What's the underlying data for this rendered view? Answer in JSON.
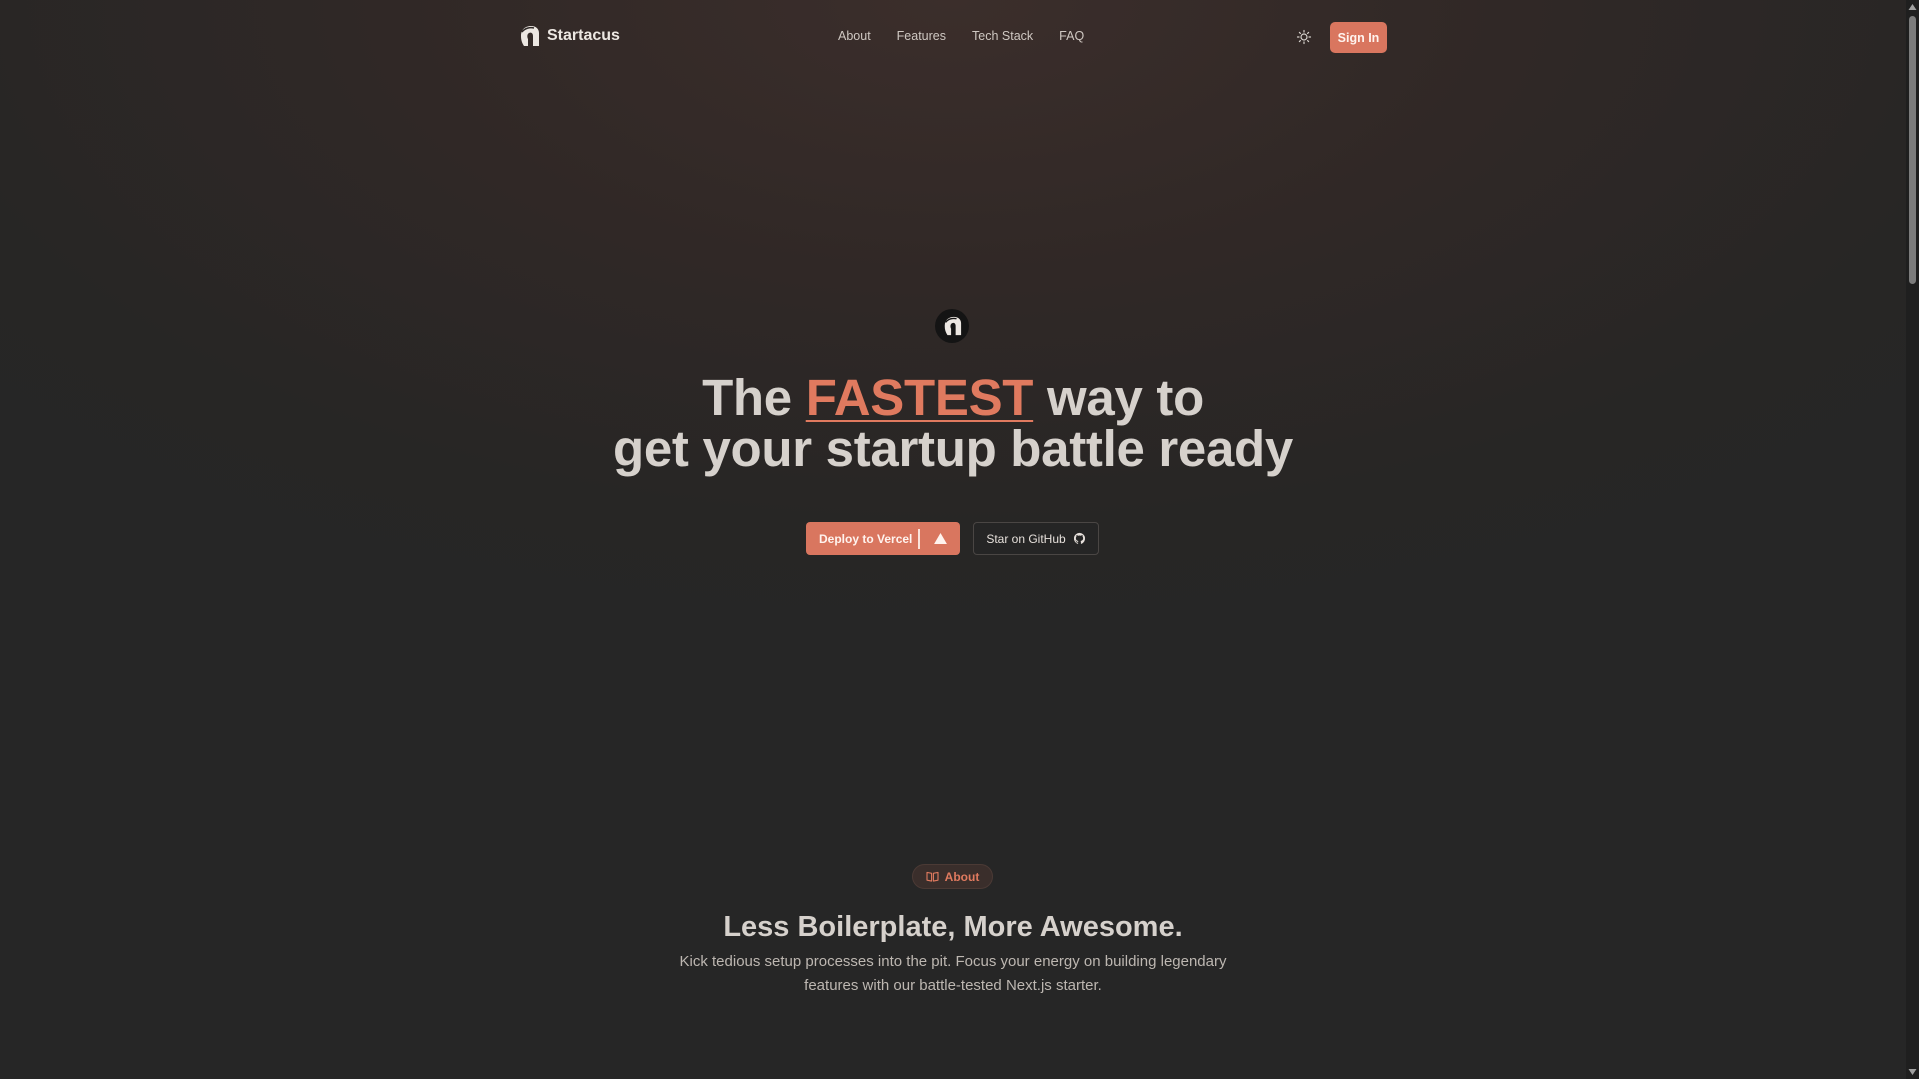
{
  "brand": {
    "name": "Startacus",
    "icon": "spartan-helmet-icon"
  },
  "nav": {
    "items": [
      {
        "label": "About"
      },
      {
        "label": "Features"
      },
      {
        "label": "Tech Stack"
      },
      {
        "label": "FAQ"
      }
    ]
  },
  "header": {
    "theme_icon": "sun-icon",
    "sign_in_label": "Sign In"
  },
  "hero": {
    "title_prefix": "The",
    "title_accent": "FASTEST",
    "title_suffix": "way to",
    "title_line2": "get your startup battle ready",
    "deploy_label": "Deploy to Vercel",
    "github_label": "Star on GitHub"
  },
  "about": {
    "pill_label": "About",
    "title": "Less Boilerplate, More Awesome.",
    "description": "Kick tedious setup processes into the pit. Focus your energy on building legendary features with our battle-tested Next.js starter."
  },
  "colors": {
    "accent": "#e07a5f",
    "button": "#d9765f",
    "background": "#262626"
  }
}
